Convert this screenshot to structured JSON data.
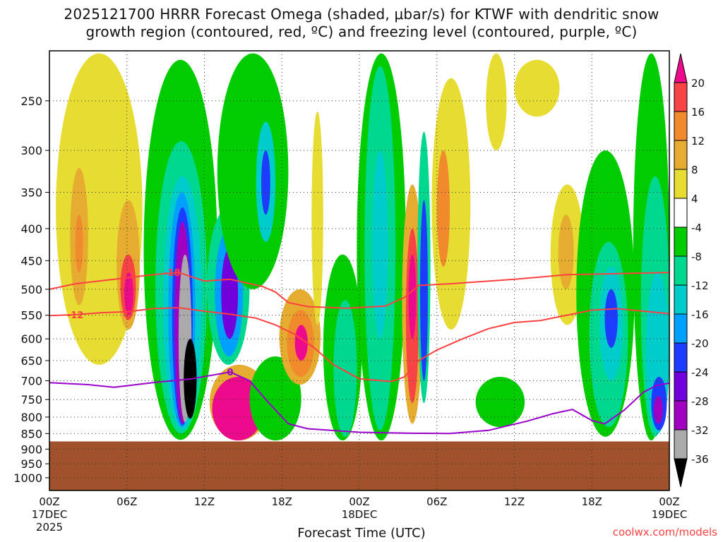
{
  "chart_data": {
    "type": "heatmap",
    "title_line1": "2025121700 HRRR Forecast Omega (shaded, μbar/s) for KTWF with dendritic snow",
    "title_line2": "growth region (contoured, red, ºC) and freezing level (contoured, purple, ºC)",
    "xlabel": "Forecast Time (UTC)",
    "ylabel": "",
    "credit": "coolwx.com/models",
    "x_range_hours": [
      0,
      48
    ],
    "y_range_hpa": [
      208,
      1048
    ],
    "y_scale": "log",
    "ground_pressure_hpa": 875,
    "x_ticks": [
      {
        "hour": 0,
        "line1": "00Z",
        "line2": "17DEC",
        "line3": "2025"
      },
      {
        "hour": 6,
        "line1": "06Z"
      },
      {
        "hour": 12,
        "line1": "12Z"
      },
      {
        "hour": 18,
        "line1": "18Z"
      },
      {
        "hour": 24,
        "line1": "00Z",
        "line2": "18DEC"
      },
      {
        "hour": 30,
        "line1": "06Z"
      },
      {
        "hour": 36,
        "line1": "12Z"
      },
      {
        "hour": 42,
        "line1": "18Z"
      },
      {
        "hour": 48,
        "line1": "00Z",
        "line2": "19DEC"
      }
    ],
    "y_ticks": [
      "250",
      "300",
      "350",
      "400",
      "450",
      "500",
      "550",
      "600",
      "650",
      "700",
      "750",
      "800",
      "850",
      "900",
      "950",
      "1000"
    ],
    "colorbar": {
      "labels": [
        "20",
        "16",
        "12",
        "8",
        "4",
        "-4",
        "-8",
        "-12",
        "-16",
        "-20",
        "-24",
        "-28",
        "-32",
        "-36"
      ],
      "above_color": "#ee0a8c",
      "below_color": "#000000",
      "colors": [
        "#f84444",
        "#f08a2c",
        "#e6ac30",
        "#e6dc32",
        "#ffffff",
        "#00cc00",
        "#00d890",
        "#00cccc",
        "#00a0ff",
        "#1e3cff",
        "#7000dc",
        "#a000c0",
        "#aaaaaa"
      ]
    },
    "omega_features": [
      {
        "t0": 0.5,
        "t1": 7.2,
        "p0": 210,
        "p1": 660,
        "value": 6
      },
      {
        "t0": 1.6,
        "t1": 3.0,
        "p0": 320,
        "p1": 530,
        "value": 10
      },
      {
        "t0": 2.0,
        "t1": 2.6,
        "p0": 380,
        "p1": 470,
        "value": 14
      },
      {
        "t0": 5.2,
        "t1": 7.0,
        "p0": 360,
        "p1": 580,
        "value": 10
      },
      {
        "t0": 5.5,
        "t1": 6.7,
        "p0": 440,
        "p1": 560,
        "value": 18
      },
      {
        "t0": 5.8,
        "t1": 6.5,
        "p0": 470,
        "p1": 550,
        "value": 22
      },
      {
        "t0": 7.3,
        "t1": 13.0,
        "p0": 215,
        "p1": 870,
        "value": -6
      },
      {
        "t0": 8.2,
        "t1": 12.2,
        "p0": 290,
        "p1": 850,
        "value": -10
      },
      {
        "t0": 8.8,
        "t1": 11.8,
        "p0": 330,
        "p1": 840,
        "value": -14
      },
      {
        "t0": 9.2,
        "t1": 11.3,
        "p0": 350,
        "p1": 830,
        "value": -18
      },
      {
        "t0": 9.5,
        "t1": 11.1,
        "p0": 370,
        "p1": 825,
        "value": -22
      },
      {
        "t0": 9.7,
        "t1": 10.9,
        "p0": 390,
        "p1": 820,
        "value": -30
      },
      {
        "t0": 10.0,
        "t1": 11.0,
        "p0": 440,
        "p1": 815,
        "value": -34
      },
      {
        "t0": 10.4,
        "t1": 11.4,
        "p0": 600,
        "p1": 805,
        "value": -40
      },
      {
        "t0": 12.2,
        "t1": 15.5,
        "p0": 370,
        "p1": 660,
        "value": -10
      },
      {
        "t0": 12.8,
        "t1": 15.0,
        "p0": 400,
        "p1": 640,
        "value": -18
      },
      {
        "t0": 13.3,
        "t1": 14.6,
        "p0": 430,
        "p1": 600,
        "value": -26
      },
      {
        "t0": 13.0,
        "t1": 18.5,
        "p0": 210,
        "p1": 500,
        "value": -6
      },
      {
        "t0": 16.0,
        "t1": 17.5,
        "p0": 270,
        "p1": 420,
        "value": -14
      },
      {
        "t0": 16.4,
        "t1": 17.1,
        "p0": 300,
        "p1": 380,
        "value": -22
      },
      {
        "t0": 12.4,
        "t1": 17.0,
        "p0": 660,
        "p1": 872,
        "value": 10
      },
      {
        "t0": 12.6,
        "t1": 16.6,
        "p0": 690,
        "p1": 872,
        "value": 22
      },
      {
        "t0": 15.5,
        "t1": 19.5,
        "p0": 640,
        "p1": 872,
        "value": -6
      },
      {
        "t0": 17.8,
        "t1": 21.0,
        "p0": 500,
        "p1": 710,
        "value": 8
      },
      {
        "t0": 18.4,
        "t1": 20.5,
        "p0": 540,
        "p1": 690,
        "value": 14
      },
      {
        "t0": 19.0,
        "t1": 20.0,
        "p0": 570,
        "p1": 650,
        "value": 22
      },
      {
        "t0": 20.3,
        "t1": 21.2,
        "p0": 260,
        "p1": 570,
        "value": 6
      },
      {
        "t0": 21.2,
        "t1": 24.2,
        "p0": 440,
        "p1": 872,
        "value": -6
      },
      {
        "t0": 22.0,
        "t1": 23.8,
        "p0": 520,
        "p1": 860,
        "value": -10
      },
      {
        "t0": 23.8,
        "t1": 27.6,
        "p0": 210,
        "p1": 872,
        "value": -6
      },
      {
        "t0": 24.4,
        "t1": 26.8,
        "p0": 220,
        "p1": 840,
        "value": -10
      },
      {
        "t0": 25.0,
        "t1": 26.2,
        "p0": 300,
        "p1": 600,
        "value": -14
      },
      {
        "t0": 27.3,
        "t1": 28.9,
        "p0": 340,
        "p1": 820,
        "value": 10
      },
      {
        "t0": 27.6,
        "t1": 28.6,
        "p0": 400,
        "p1": 760,
        "value": 16
      },
      {
        "t0": 27.8,
        "t1": 28.4,
        "p0": 440,
        "p1": 600,
        "value": 22
      },
      {
        "t0": 28.5,
        "t1": 29.5,
        "p0": 280,
        "p1": 760,
        "value": -10
      },
      {
        "t0": 28.7,
        "t1": 29.3,
        "p0": 360,
        "p1": 700,
        "value": -22
      },
      {
        "t0": 29.6,
        "t1": 32.6,
        "p0": 230,
        "p1": 580,
        "value": 6
      },
      {
        "t0": 30.0,
        "t1": 31.0,
        "p0": 300,
        "p1": 460,
        "value": 12
      },
      {
        "t0": 33.0,
        "t1": 36.8,
        "p0": 690,
        "p1": 830,
        "value": -6
      },
      {
        "t0": 33.8,
        "t1": 35.4,
        "p0": 210,
        "p1": 300,
        "value": 6
      },
      {
        "t0": 36.0,
        "t1": 39.5,
        "p0": 215,
        "p1": 265,
        "value": 6
      },
      {
        "t0": 38.8,
        "t1": 41.4,
        "p0": 340,
        "p1": 570,
        "value": 6
      },
      {
        "t0": 39.4,
        "t1": 40.6,
        "p0": 380,
        "p1": 500,
        "value": 10
      },
      {
        "t0": 40.8,
        "t1": 45.3,
        "p0": 300,
        "p1": 860,
        "value": -6
      },
      {
        "t0": 41.8,
        "t1": 44.8,
        "p0": 420,
        "p1": 830,
        "value": -10
      },
      {
        "t0": 42.6,
        "t1": 44.4,
        "p0": 460,
        "p1": 700,
        "value": -16
      },
      {
        "t0": 43.0,
        "t1": 44.0,
        "p0": 500,
        "p1": 620,
        "value": -22
      },
      {
        "t0": 45.2,
        "t1": 48.0,
        "p0": 210,
        "p1": 872,
        "value": -6
      },
      {
        "t0": 45.8,
        "t1": 48.0,
        "p0": 330,
        "p1": 860,
        "value": -10
      },
      {
        "t0": 46.2,
        "t1": 48.0,
        "p0": 470,
        "p1": 850,
        "value": -16
      },
      {
        "t0": 46.6,
        "t1": 47.8,
        "p0": 690,
        "p1": 840,
        "value": -22
      },
      {
        "t0": 46.8,
        "t1": 47.5,
        "p0": 740,
        "p1": 820,
        "value": -30
      }
    ],
    "contours": [
      {
        "name": "dgz -18C",
        "color": "#ff4040",
        "label": "-18",
        "label_at": [
          9.5,
          470
        ],
        "points": [
          [
            0,
            500
          ],
          [
            2,
            490
          ],
          [
            5,
            482
          ],
          [
            8,
            474
          ],
          [
            10,
            470
          ],
          [
            12,
            485
          ],
          [
            14,
            482
          ],
          [
            16.5,
            495
          ],
          [
            17.5,
            505
          ],
          [
            18.5,
            525
          ],
          [
            20,
            533
          ],
          [
            23,
            536
          ],
          [
            26,
            532
          ],
          [
            27.5,
            515
          ],
          [
            28.6,
            493
          ],
          [
            31,
            490
          ],
          [
            36,
            482
          ],
          [
            40,
            474
          ],
          [
            44,
            472
          ],
          [
            48,
            470
          ]
        ]
      },
      {
        "name": "dgz -12C",
        "color": "#ff4040",
        "label": "-12",
        "label_at": [
          2.0,
          549
        ],
        "points": [
          [
            0,
            551
          ],
          [
            2,
            549
          ],
          [
            4,
            545
          ],
          [
            6,
            543
          ],
          [
            8,
            537
          ],
          [
            10,
            535
          ],
          [
            12,
            542
          ],
          [
            14,
            548
          ],
          [
            16,
            556
          ],
          [
            17.5,
            570
          ],
          [
            19,
            590
          ],
          [
            20.5,
            620
          ],
          [
            22,
            660
          ],
          [
            24,
            695
          ],
          [
            26.5,
            702
          ],
          [
            27.5,
            690
          ],
          [
            28.6,
            650
          ],
          [
            30,
            625
          ],
          [
            32,
            600
          ],
          [
            34,
            578
          ],
          [
            36,
            565
          ],
          [
            38,
            561
          ],
          [
            42,
            540
          ],
          [
            44,
            537
          ],
          [
            48,
            547
          ]
        ]
      },
      {
        "name": "freezing level 0C",
        "color": "#9a00cc",
        "label": "0",
        "label_at": [
          14.0,
          678
        ],
        "points": [
          [
            0,
            705
          ],
          [
            3,
            710
          ],
          [
            5,
            717
          ],
          [
            8,
            705
          ],
          [
            11,
            695
          ],
          [
            14,
            678
          ],
          [
            15.5,
            700
          ],
          [
            17,
            760
          ],
          [
            18.5,
            820
          ],
          [
            20,
            835
          ],
          [
            24,
            846
          ],
          [
            28,
            849
          ],
          [
            31,
            850
          ],
          [
            34,
            840
          ],
          [
            37,
            812
          ],
          [
            39,
            790
          ],
          [
            40.5,
            778
          ],
          [
            42,
            810
          ],
          [
            43,
            820
          ],
          [
            44.5,
            780
          ],
          [
            46,
            730
          ],
          [
            47,
            712
          ],
          [
            48,
            706
          ]
        ]
      }
    ]
  }
}
